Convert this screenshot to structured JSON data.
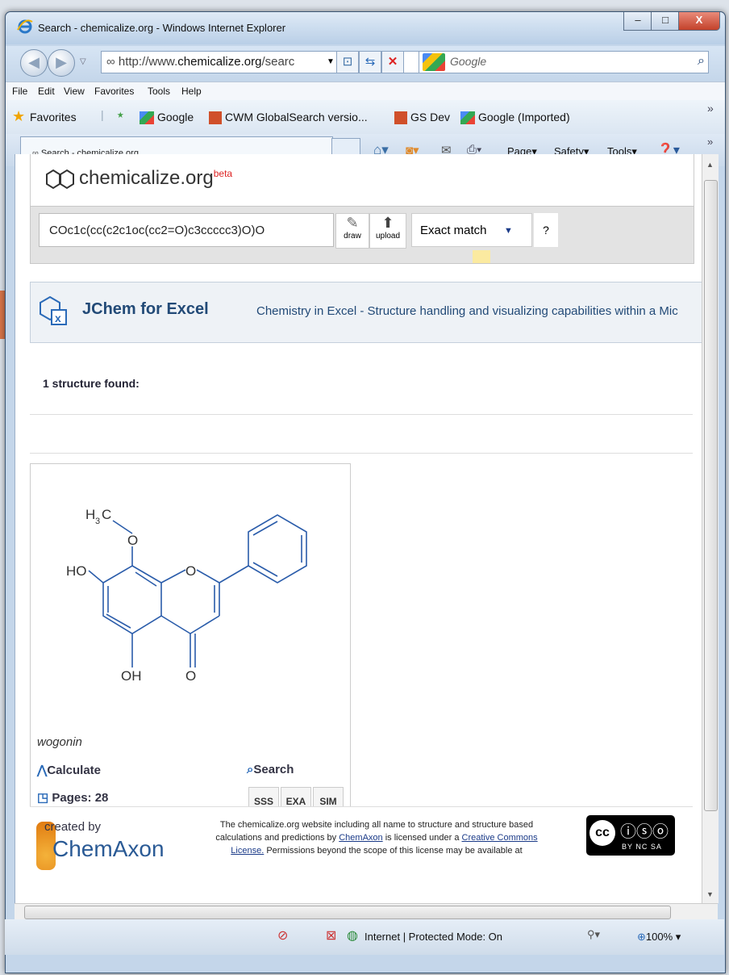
{
  "window": {
    "title": "Search - chemicalize.org - Windows Internet Explorer",
    "minimize": "–",
    "maximize": "□",
    "close": "X"
  },
  "nav": {
    "url_prefix": "http://www.",
    "url_domain": "chemicalize.org",
    "url_rest": "/searc",
    "search_placeholder": "Google"
  },
  "menu": [
    "File",
    "Edit",
    "View",
    "Favorites",
    "Tools",
    "Help"
  ],
  "favorites": {
    "label": "Favorites",
    "items": [
      "Google",
      "CWM GlobalSearch versio...",
      "GS Dev",
      "Google (Imported)"
    ]
  },
  "tab": {
    "label": "Search - chemicalize.org"
  },
  "commands": [
    "Page",
    "Safety",
    "Tools"
  ],
  "page": {
    "logo": "chemicalize.org",
    "logo_sup": "beta",
    "search": {
      "smiles": "COc1c(cc(c2c1oc(cc2=O)c3ccccc3)O)O",
      "draw": "draw",
      "upload": "upload",
      "mode": "Exact match",
      "help": "?"
    },
    "jchem": {
      "title": "JChem for Excel",
      "description": "Chemistry in Excel - Structure handling and visualizing capabilities within a Mic"
    },
    "results": {
      "count_text": "1 structure found:",
      "molecule": {
        "name": "wogonin",
        "labels": {
          "h3c_h": "H",
          "h3c_3": "3",
          "h3c_c": "C",
          "o_methoxy": "O",
          "ho": "HO",
          "o_ring": "O",
          "oh": "OH",
          "o_keto": "O"
        },
        "calculate": "Calculate",
        "search": "Search",
        "pages": "Pages: 28",
        "buttons": [
          "SSS",
          "EXA",
          "SIM"
        ]
      }
    },
    "footer": {
      "created_by": "created by",
      "company": "ChemAxon",
      "license_1": "The chemicalize.org website including all name to structure and structure based",
      "license_2a": "calculations and predictions by ",
      "license_2b": "ChemAxon",
      "license_2c": " is licensed under a ",
      "license_2d": "Creative Commons",
      "license_3a": "License.",
      "license_3b": " Permissions beyond the scope of this license may be available at",
      "cc_text": "BY NC SA"
    }
  },
  "status": {
    "zone": "Internet | Protected Mode: On",
    "zoom": "100%"
  }
}
